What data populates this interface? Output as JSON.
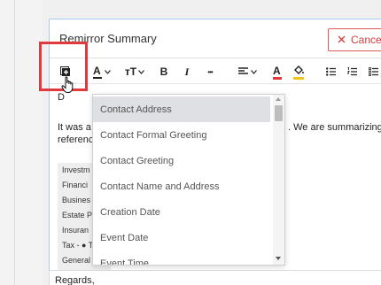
{
  "dialog": {
    "title": "Remirror Summary",
    "cancel_label": "Cance"
  },
  "toolbar": {
    "text_color_label": "A",
    "font_size_label": "тT",
    "bold_label": "B",
    "italic_label": "I",
    "more_label": "•••",
    "text_highlight_label": "A"
  },
  "editor": {
    "greeting": "D",
    "para_left": "It was a p",
    "para_right": ". We are summarizing",
    "para_line2": "referenc",
    "table_rows": [
      "Investm",
      "Financi",
      "Busines",
      "Estate P",
      "Insuran",
      "Tax - ● T",
      "General"
    ],
    "regards": "Regards,"
  },
  "dropdown": {
    "items": [
      "Contact Address",
      "Contact Formal Greeting",
      "Contact Greeting",
      "Contact Name and Address",
      "Creation Date",
      "Event Date",
      "Event Time"
    ],
    "active_index": 0
  },
  "colors": {
    "accent_red": "#e0393e",
    "cancel_red": "#d93c3c",
    "text_color_bar": "#e03a3a",
    "highlight_bar": "#f0c419"
  }
}
